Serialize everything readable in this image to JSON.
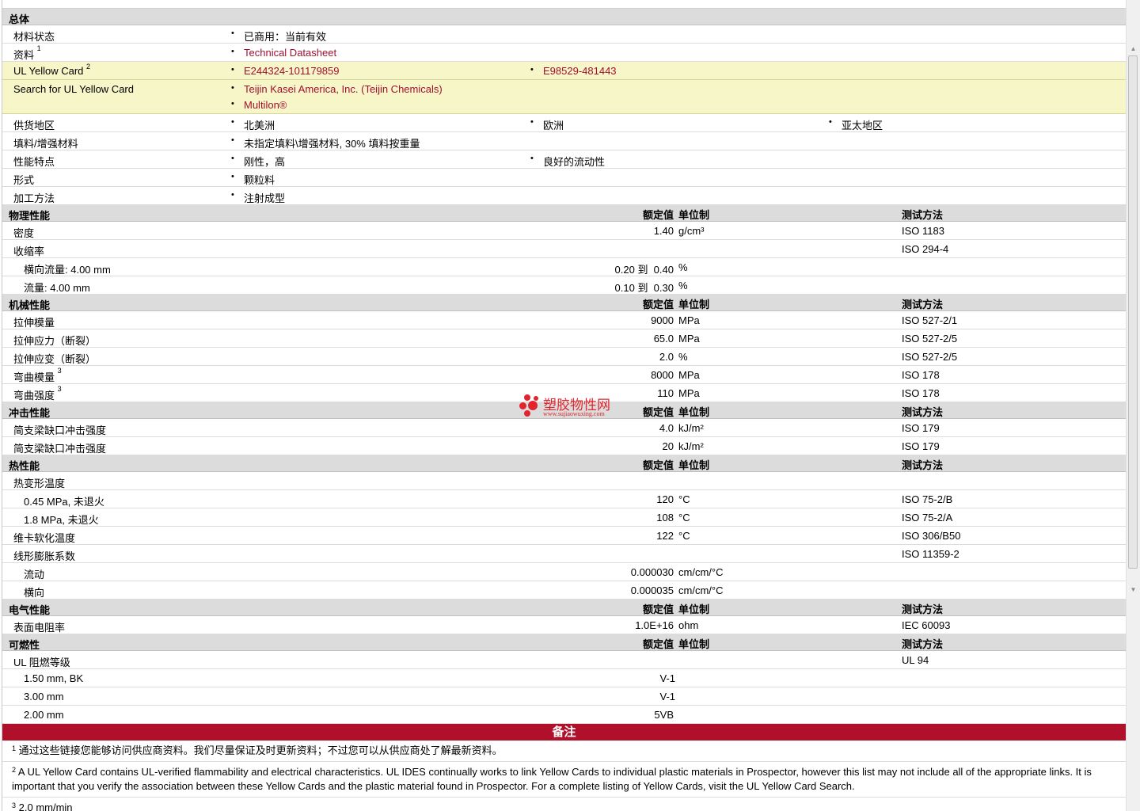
{
  "general": {
    "title": "总体",
    "rows": [
      {
        "label": "材料状态",
        "values": [
          "已商用：当前有效"
        ]
      },
      {
        "label": "资料",
        "sup": "1",
        "values": [
          "Technical Datasheet"
        ],
        "link": true
      },
      {
        "label": "UL Yellow Card",
        "sup": "2",
        "values": [
          "E244324-101179859",
          "E98529-481443"
        ],
        "link": true,
        "highlight": true
      },
      {
        "label": "Search for UL Yellow Card",
        "values": [
          "Teijin Kasei America, Inc. (Teijin Chemicals)",
          "Multilon®"
        ],
        "link": true,
        "highlight": true,
        "stacked": true
      },
      {
        "label": "供货地区",
        "values": [
          "北美洲",
          "欧洲",
          "亚太地区"
        ]
      },
      {
        "label": "填料/增强材料",
        "values": [
          "未指定填料\\增强材料, 30% 填料按重量"
        ]
      },
      {
        "label": "性能特点",
        "values": [
          "刚性，高",
          "良好的流动性"
        ]
      },
      {
        "label": "形式",
        "values": [
          "颗粒料"
        ]
      },
      {
        "label": "加工方法",
        "values": [
          "注射成型"
        ]
      }
    ]
  },
  "headers": {
    "value": "额定值",
    "unit": "单位制",
    "test": "测试方法"
  },
  "sections": [
    {
      "title": "物理性能",
      "rows": [
        {
          "label": "密度",
          "value": "1.40",
          "unit": "g/cm³",
          "test": "ISO 1183"
        },
        {
          "label": "收缩率",
          "value": "",
          "unit": "",
          "test": "ISO 294-4"
        },
        {
          "label": "横向流量: 4.00 mm",
          "indent": true,
          "value": "0.20 到  0.40",
          "unit": "%",
          "test": ""
        },
        {
          "label": "流量: 4.00 mm",
          "indent": true,
          "value": "0.10 到  0.30",
          "unit": "%",
          "test": ""
        }
      ]
    },
    {
      "title": "机械性能",
      "rows": [
        {
          "label": "拉伸模量",
          "value": "9000",
          "unit": "MPa",
          "test": "ISO 527-2/1"
        },
        {
          "label": "拉伸应力（断裂）",
          "value": "65.0",
          "unit": "MPa",
          "test": "ISO 527-2/5"
        },
        {
          "label": "拉伸应变（断裂）",
          "value": "2.0",
          "unit": "%",
          "test": "ISO 527-2/5"
        },
        {
          "label": "弯曲模量",
          "sup": "3",
          "value": "8000",
          "unit": "MPa",
          "test": "ISO 178"
        },
        {
          "label": "弯曲强度",
          "sup": "3",
          "value": "110",
          "unit": "MPa",
          "test": "ISO 178"
        }
      ]
    },
    {
      "title": "冲击性能",
      "rows": [
        {
          "label": "简支梁缺口冲击强度",
          "value": "4.0",
          "unit": "kJ/m²",
          "test": "ISO 179"
        },
        {
          "label": "简支梁缺口冲击强度",
          "value": "20",
          "unit": "kJ/m²",
          "test": "ISO 179"
        }
      ]
    },
    {
      "title": "热性能",
      "rows": [
        {
          "label": "热变形温度",
          "value": "",
          "unit": "",
          "test": ""
        },
        {
          "label": "0.45 MPa, 未退火",
          "indent": true,
          "value": "120",
          "unit": "°C",
          "test": "ISO 75-2/B"
        },
        {
          "label": "1.8 MPa, 未退火",
          "indent": true,
          "value": "108",
          "unit": "°C",
          "test": "ISO 75-2/A"
        },
        {
          "label": "维卡软化温度",
          "value": "122",
          "unit": "°C",
          "test": "ISO 306/B50"
        },
        {
          "label": "线形膨胀系数",
          "value": "",
          "unit": "",
          "test": "ISO 11359-2"
        },
        {
          "label": "流动",
          "indent": true,
          "value": "0.000030",
          "unit": "cm/cm/°C",
          "test": ""
        },
        {
          "label": "横向",
          "indent": true,
          "value": "0.000035",
          "unit": "cm/cm/°C",
          "test": ""
        }
      ]
    },
    {
      "title": "电气性能",
      "rows": [
        {
          "label": "表面电阻率",
          "value": "1.0E+16",
          "unit": "ohm",
          "test": "IEC 60093"
        }
      ]
    },
    {
      "title": "可燃性",
      "rows": [
        {
          "label": "UL 阻燃等级",
          "value": "",
          "unit": "",
          "test": "UL 94"
        },
        {
          "label": "1.50 mm, BK",
          "indent": true,
          "value": "V-1",
          "unit": "",
          "test": "",
          "center": true
        },
        {
          "label": "3.00 mm",
          "indent": true,
          "value": "V-1",
          "unit": "",
          "test": "",
          "center": true
        },
        {
          "label": "2.00 mm",
          "indent": true,
          "value": "5VB",
          "unit": "",
          "test": ""
        }
      ]
    }
  ],
  "notes": {
    "title": "备注",
    "items": [
      {
        "sup": "1",
        "text": "通过这些链接您能够访问供应商资料。我们尽量保证及时更新资料；不过您可以从供应商处了解最新资料。"
      },
      {
        "sup": "2",
        "text": "A UL Yellow Card contains UL-verified flammability and electrical characteristics. UL IDES continually works to link Yellow Cards to individual plastic materials in Prospector, however this list may not include all of the appropriate links. It is important that you verify the association between these Yellow Cards and the plastic material found in Prospector. For a complete listing of Yellow Cards, visit the UL Yellow Card Search."
      },
      {
        "sup": "3",
        "text": "2.0 mm/min"
      }
    ]
  },
  "watermark": {
    "name": "塑胶物性网",
    "url": "www.sujiaowuxing.com"
  },
  "colors": {
    "link": "#a0102e",
    "notes_bar": "#b0102a",
    "section_bg": "#dcdcdc",
    "highlight_bg": "#f6f6c8"
  }
}
